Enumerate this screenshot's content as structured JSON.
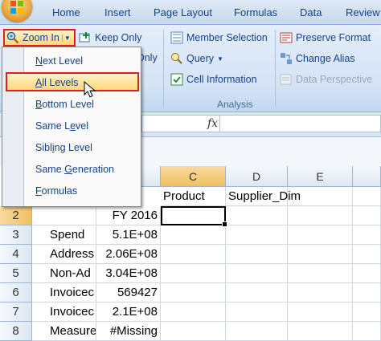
{
  "tabs": [
    "Home",
    "Insert",
    "Page Layout",
    "Formulas",
    "Data",
    "Review"
  ],
  "ribbon": {
    "zoom_in": "Zoom In",
    "keep_only": "Keep Only",
    "remove_only_partial": "Only",
    "member_selection": "Member Selection",
    "query": "Query",
    "cell_information": "Cell Information",
    "preserve_format": "Preserve Format",
    "change_alias": "Change Alias",
    "data_perspective": "Data Perspective",
    "group_label": "Analysis"
  },
  "formula_bar": {
    "fx": "fx"
  },
  "menu": {
    "items": [
      {
        "pre": "",
        "u": "N",
        "post": "ext Level"
      },
      {
        "pre": "",
        "u": "A",
        "post": "ll Levels"
      },
      {
        "pre": "",
        "u": "B",
        "post": "ottom Level"
      },
      {
        "pre": "Same L",
        "u": "e",
        "post": "vel"
      },
      {
        "pre": "Sibl",
        "u": "i",
        "post": "ng Level"
      },
      {
        "pre": "Same ",
        "u": "G",
        "post": "eneration"
      },
      {
        "pre": "",
        "u": "F",
        "post": "ormulas"
      }
    ]
  },
  "grid": {
    "columns": [
      "C",
      "D",
      "E"
    ],
    "rows": [
      "2",
      "3",
      "4",
      "5",
      "6",
      "7",
      "8"
    ],
    "row1": {
      "c": "Product",
      "d": "Supplier_Dim"
    },
    "cells": [
      {
        "a": "",
        "b": "FY 2016"
      },
      {
        "a": "Spend",
        "b": "5.1E+08"
      },
      {
        "a": "Address",
        "b": "2.06E+08"
      },
      {
        "a": "Non-Ad",
        "b": "3.04E+08"
      },
      {
        "a": "Invoicec",
        "b": "569427"
      },
      {
        "a": "Invoicec",
        "b": "2.1E+08"
      },
      {
        "a": "Measures",
        "b": "#Missing"
      }
    ]
  }
}
